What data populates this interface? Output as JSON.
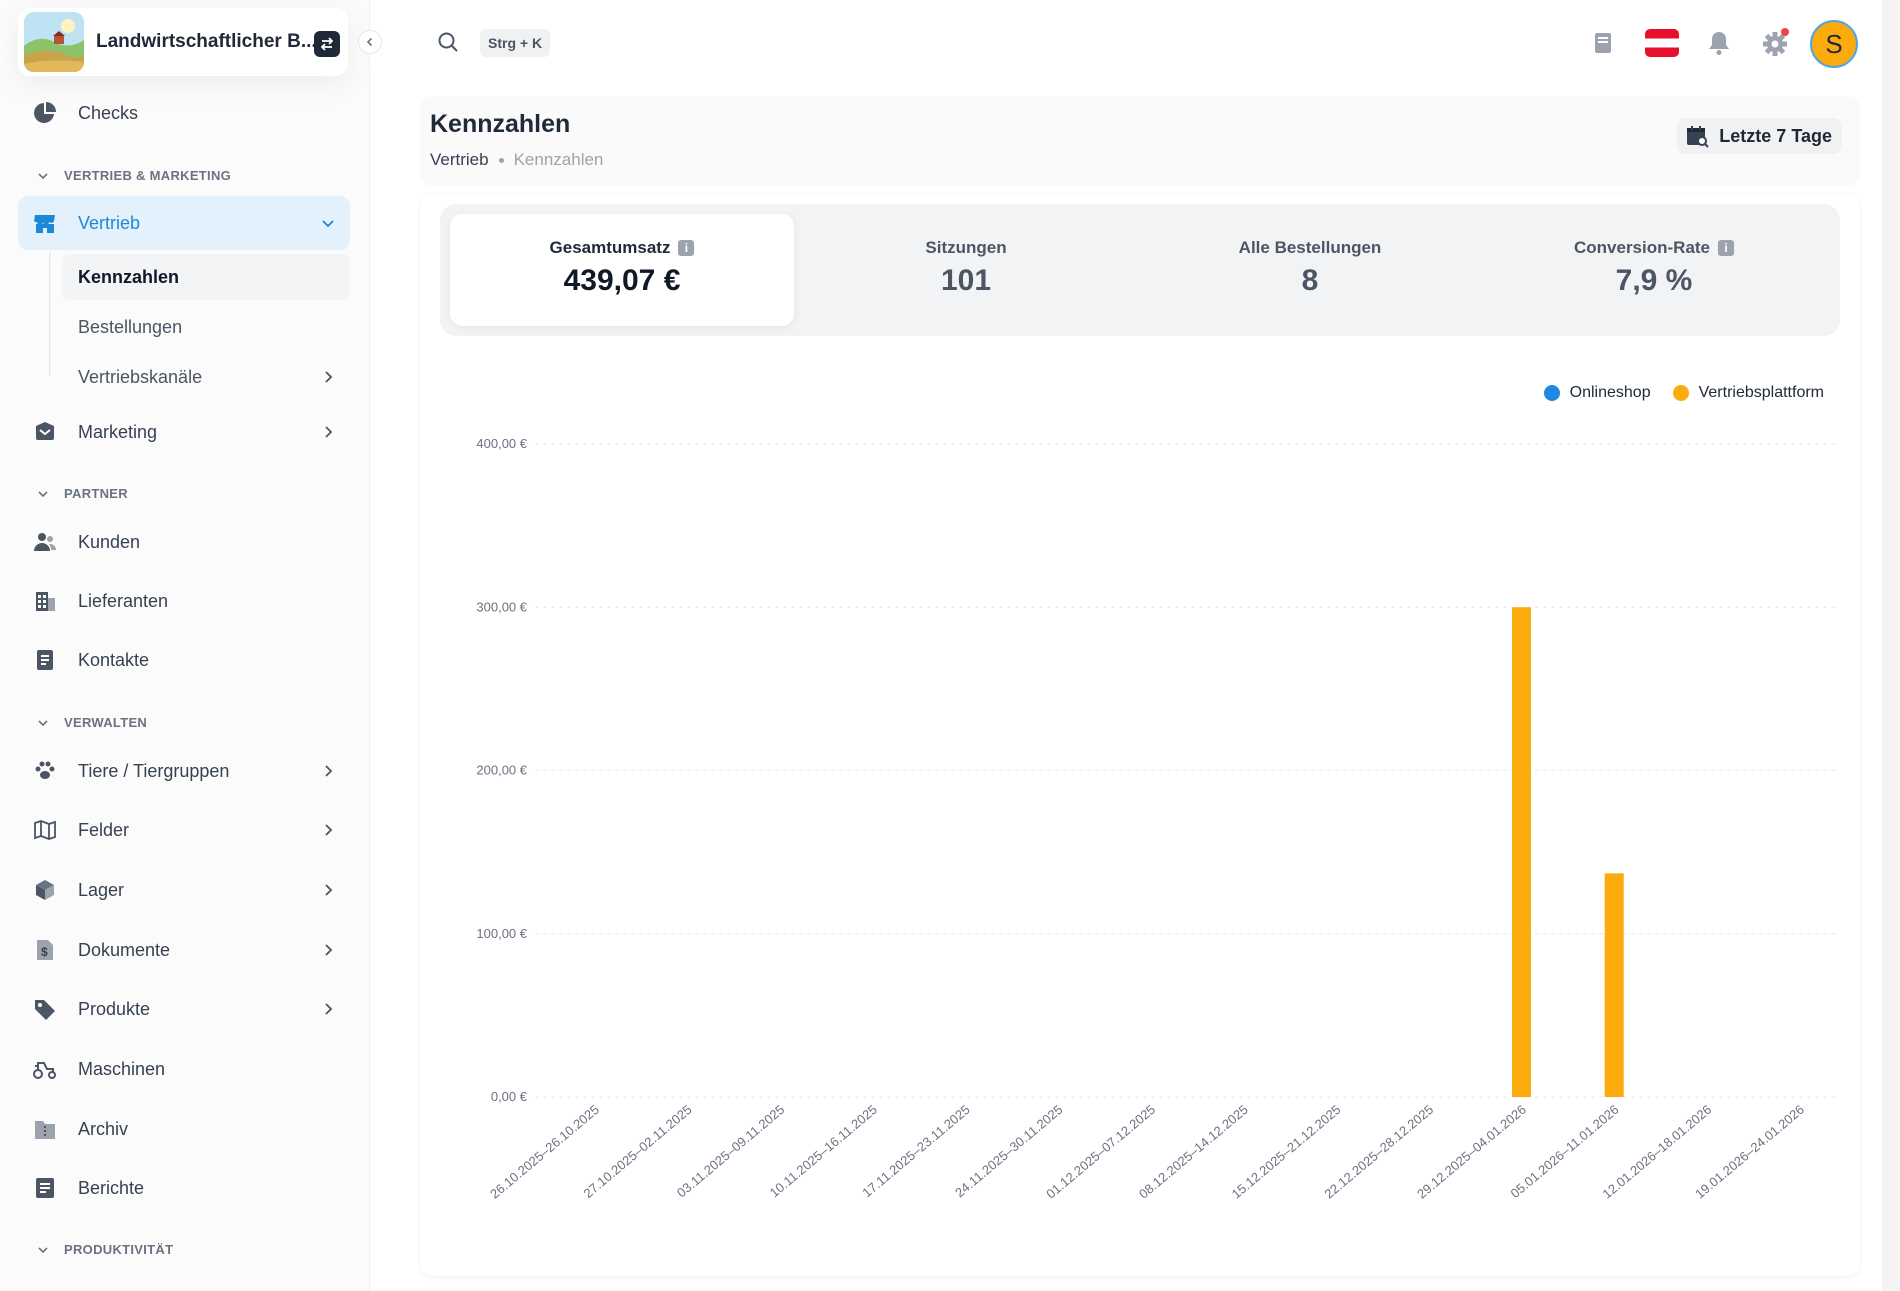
{
  "org": {
    "name": "Landwirtschaftlicher B..."
  },
  "sidebar": {
    "checks": "Checks",
    "sections": {
      "vertrieb_marketing": "VERTRIEB & MARKETING",
      "partner": "PARTNER",
      "verwalten": "VERWALTEN",
      "produktivitaet": "PRODUKTIVITÄT"
    },
    "vertrieb": "Vertrieb",
    "sub": {
      "kennzahlen": "Kennzahlen",
      "bestellungen": "Bestellungen",
      "vertriebskanaele": "Vertriebskanäle"
    },
    "marketing": "Marketing",
    "kunden": "Kunden",
    "lieferanten": "Lieferanten",
    "kontakte": "Kontakte",
    "tiere": "Tiere / Tiergruppen",
    "felder": "Felder",
    "lager": "Lager",
    "dokumente": "Dokumente",
    "produkte": "Produkte",
    "maschinen": "Maschinen",
    "archiv": "Archiv",
    "berichte": "Berichte"
  },
  "topbar": {
    "shortcut": "Strg + K",
    "avatar_initial": "S"
  },
  "page": {
    "title": "Kennzahlen",
    "breadcrumb": [
      "Vertrieb",
      "Kennzahlen"
    ],
    "date_range": "Letzte 7 Tage"
  },
  "kpis": [
    {
      "label": "Gesamtumsatz",
      "value": "439,07 €",
      "info": true,
      "selected": true
    },
    {
      "label": "Sitzungen",
      "value": "101",
      "info": false,
      "selected": false
    },
    {
      "label": "Alle Bestellungen",
      "value": "8",
      "info": false,
      "selected": false
    },
    {
      "label": "Conversion-Rate",
      "value": "7,9 %",
      "info": true,
      "selected": false
    }
  ],
  "colors": {
    "accent": "#1e88d6",
    "onlineshop": "#1e88e5",
    "vertriebsplattform": "#fbab0d"
  },
  "chart_data": {
    "type": "bar",
    "categories": [
      "26.10.2025–26.10.2025",
      "27.10.2025–02.11.2025",
      "03.11.2025–09.11.2025",
      "10.11.2025–16.11.2025",
      "17.11.2025–23.11.2025",
      "24.11.2025–30.11.2025",
      "01.12.2025–07.12.2025",
      "08.12.2025–14.12.2025",
      "15.12.2025–21.12.2025",
      "22.12.2025–28.12.2025",
      "29.12.2025–04.01.2026",
      "05.01.2026–11.01.2026",
      "12.01.2026–18.01.2026",
      "19.01.2026–24.01.2026"
    ],
    "series": [
      {
        "name": "Onlineshop",
        "values": [
          0,
          0,
          0,
          0,
          0,
          0,
          0,
          0,
          0,
          0,
          0,
          0,
          0,
          0
        ]
      },
      {
        "name": "Vertriebsplattform",
        "values": [
          0,
          0,
          0,
          0,
          0,
          0,
          0,
          0,
          0,
          0,
          300,
          137,
          0,
          0
        ]
      }
    ],
    "yticks": [
      "0,00 €",
      "100,00 €",
      "200,00 €",
      "300,00 €",
      "400,00 €"
    ],
    "ylim": [
      0,
      400
    ],
    "grid": true,
    "legend_position": "top-right"
  }
}
